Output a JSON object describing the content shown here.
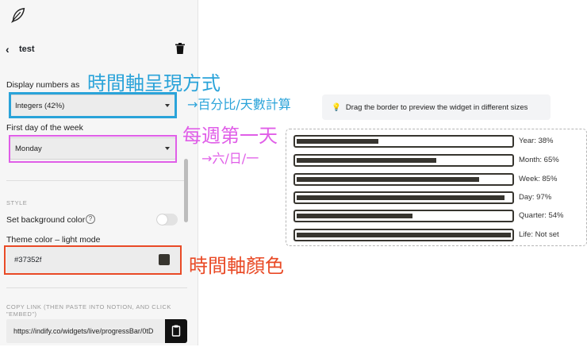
{
  "sidebar": {
    "widget_title": "test",
    "display_numbers": {
      "label": "Display numbers as",
      "value": "Integers (42%)"
    },
    "first_day": {
      "label": "First day of the week",
      "value": "Monday"
    },
    "style_section": "STYLE",
    "background_color": {
      "label": "Set background color",
      "help": "?",
      "enabled": false
    },
    "theme_color": {
      "label": "Theme color – light mode",
      "value": "#37352f"
    },
    "copy_link": {
      "label": "COPY LINK (THEN PASTE INTO NOTION, AND CLICK \"EMBED\")",
      "url": "https://indify.co/widgets/live/progressBar/0tD"
    }
  },
  "annotations": {
    "display_mode": "時間軸呈現方式",
    "display_mode_sub": "→百分比/天數計算",
    "first_day": "每週第一天",
    "first_day_sub": "→六/日/一",
    "color": "時間軸顏色"
  },
  "colors": {
    "annot_blue": "#2aa3d9",
    "annot_pink": "#e05ee8",
    "annot_red": "#e94a26",
    "bar": "#37352f"
  },
  "preview": {
    "tip": "Drag the border to preview the widget in different sizes",
    "bars": [
      {
        "label": "Year: 38%",
        "fraction": 0.38
      },
      {
        "label": "Month: 65%",
        "fraction": 0.65
      },
      {
        "label": "Week: 85%",
        "fraction": 0.85
      },
      {
        "label": "Day: 97%",
        "fraction": 0.97
      },
      {
        "label": "Quarter: 54%",
        "fraction": 0.54
      },
      {
        "label": "Life: Not set",
        "fraction": 1.0
      }
    ]
  }
}
